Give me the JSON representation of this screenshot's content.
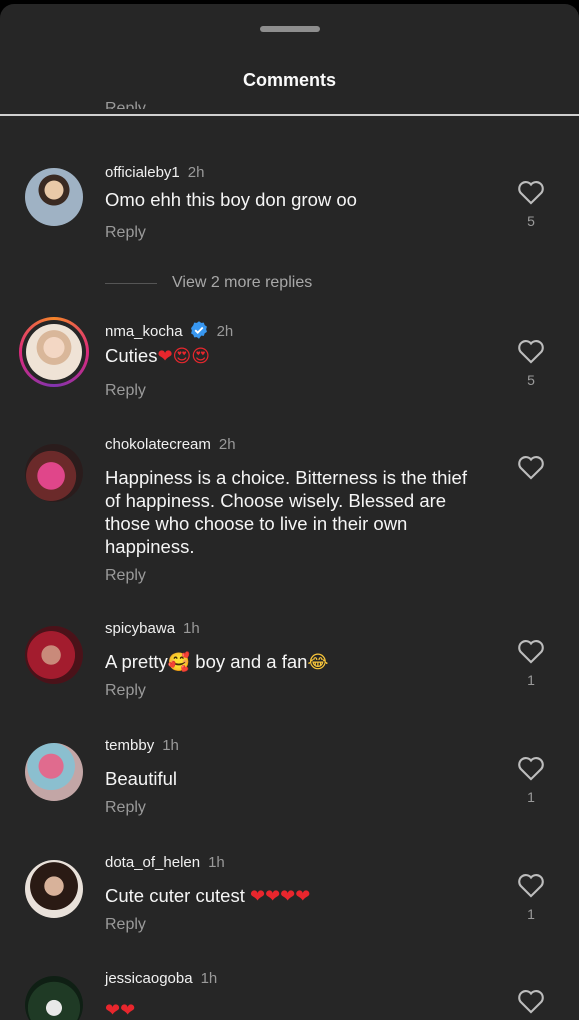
{
  "header": {
    "title": "Comments",
    "partial_reply": "Reply"
  },
  "more_replies_label": "View 2 more replies",
  "colors": {
    "sheet_bg": "#262626",
    "text_secondary": "#9a9a9a",
    "heart_red": "#e8262d",
    "verified_blue": "#3897f0"
  },
  "comments": [
    {
      "user": "officialeby1",
      "time": "2h",
      "text": "Omo ehh this boy don grow oo",
      "reply": "Reply",
      "likes": "5",
      "avatar": "avatar-photo"
    },
    {
      "user": "nma_kocha",
      "time": "2h",
      "text": "Cuties",
      "emoji": "❤😍😍",
      "reply": "Reply",
      "likes": "5",
      "verified": true,
      "avatar": "avatar-photo-story-ring"
    },
    {
      "user": "chokolatecream",
      "time": "2h",
      "text": "Happiness is a choice. Bitterness is the thief of happiness. Choose wisely. Blessed are those who choose to live in their own happiness.",
      "reply": "Reply",
      "likes": "",
      "avatar": "avatar-photo"
    },
    {
      "user": "spicybawa",
      "time": "1h",
      "text_a": "A pretty",
      "emoji_a": "🥰",
      "text_b": " boy and a fan",
      "emoji_b": "😂",
      "reply": "Reply",
      "likes": "1",
      "avatar": "avatar-photo"
    },
    {
      "user": "tembby",
      "time": "1h",
      "text": "Beautiful",
      "reply": "Reply",
      "likes": "1",
      "avatar": "avatar-photo"
    },
    {
      "user": "dota_of_helen",
      "time": "1h",
      "text": "Cute cuter cutest ",
      "emoji": "❤❤❤❤",
      "reply": "Reply",
      "likes": "1",
      "avatar": "avatar-photo"
    },
    {
      "user": "jessicaogoba",
      "time": "1h",
      "emoji": "❤❤",
      "likes": "",
      "avatar": "avatar-photo"
    }
  ]
}
